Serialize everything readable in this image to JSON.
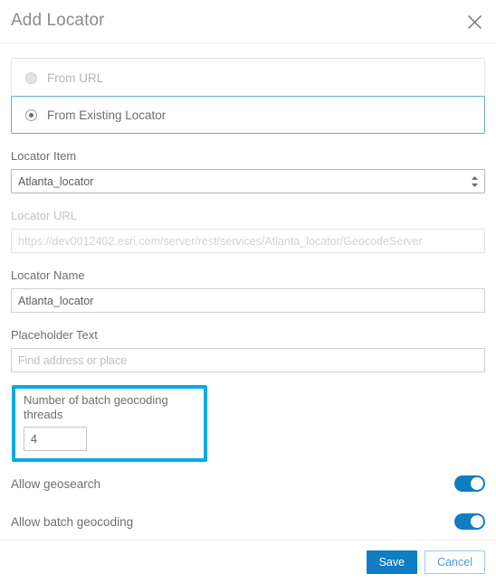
{
  "dialog": {
    "title": "Add Locator",
    "close_icon": "close-icon"
  },
  "source": {
    "options": [
      {
        "label": "From URL",
        "selected": false
      },
      {
        "label": "From Existing Locator",
        "selected": true
      }
    ]
  },
  "fields": {
    "locator_item": {
      "label": "Locator Item",
      "value": "Atlanta_locator",
      "icon": "select-arrows-icon"
    },
    "locator_url": {
      "label": "Locator URL",
      "value": "",
      "placeholder": "https://dev0012402.esri.com/server/rest/services/Atlanta_locator/GeocodeServer",
      "disabled": true
    },
    "locator_name": {
      "label": "Locator Name",
      "value": "Atlanta_locator",
      "placeholder": ""
    },
    "placeholder_text": {
      "label": "Placeholder Text",
      "value": "",
      "placeholder": "Find address or place"
    },
    "batch_threads": {
      "label": "Number of batch geocoding threads",
      "value": "4",
      "highlighted": true,
      "highlight_color": "#00ACE8"
    }
  },
  "toggles": [
    {
      "label": "Allow geosearch",
      "on": true
    },
    {
      "label": "Allow batch geocoding",
      "on": true
    }
  ],
  "footer": {
    "save_label": "Save",
    "cancel_label": "Cancel"
  },
  "colors": {
    "accent_blue": "#0f7dc2",
    "highlight_cyan": "#00ACE8",
    "selected_border": "#6ba7d6",
    "text_gray": "#6e6e6e"
  }
}
